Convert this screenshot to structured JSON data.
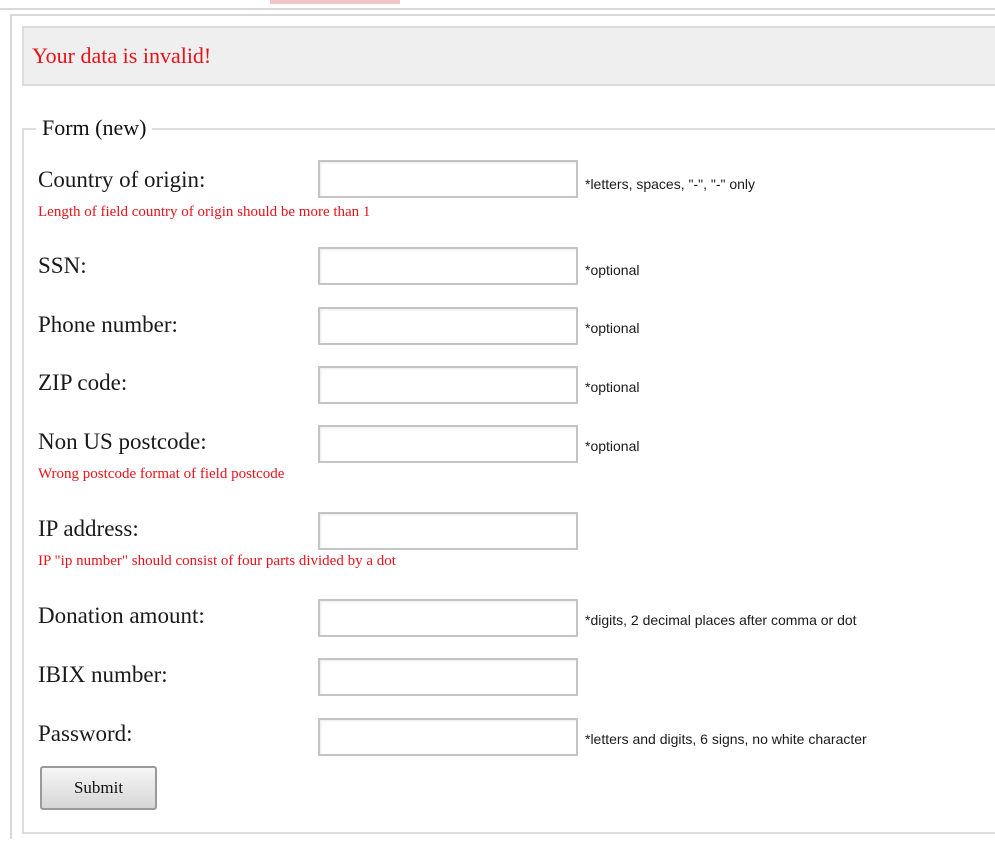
{
  "banner": {
    "message": "Your data is invalid!"
  },
  "form": {
    "legend": "Form (new)",
    "submit_label": "Submit",
    "fields": [
      {
        "label": "Country of origin:",
        "value": "",
        "hint": "*letters, spaces, \"-\", \"-\" only",
        "error": "Length of field country of origin should be more than 1"
      },
      {
        "label": "SSN:",
        "value": "",
        "hint": "*optional",
        "error": ""
      },
      {
        "label": "Phone number:",
        "value": "",
        "hint": "*optional",
        "error": ""
      },
      {
        "label": "ZIP code:",
        "value": "",
        "hint": "*optional",
        "error": ""
      },
      {
        "label": "Non US postcode:",
        "value": "",
        "hint": "*optional",
        "error": "Wrong postcode format of field postcode"
      },
      {
        "label": "IP address:",
        "value": "",
        "hint": "",
        "error": "IP \"ip number\" should consist of four parts divided by a dot"
      },
      {
        "label": "Donation amount:",
        "value": "",
        "hint": "*digits, 2 decimal places after comma or dot",
        "error": ""
      },
      {
        "label": "IBIX number:",
        "value": "",
        "hint": "",
        "error": ""
      },
      {
        "label": "Password:",
        "value": "",
        "hint": "*letters and digits, 6 signs, no white character",
        "error": ""
      }
    ]
  }
}
